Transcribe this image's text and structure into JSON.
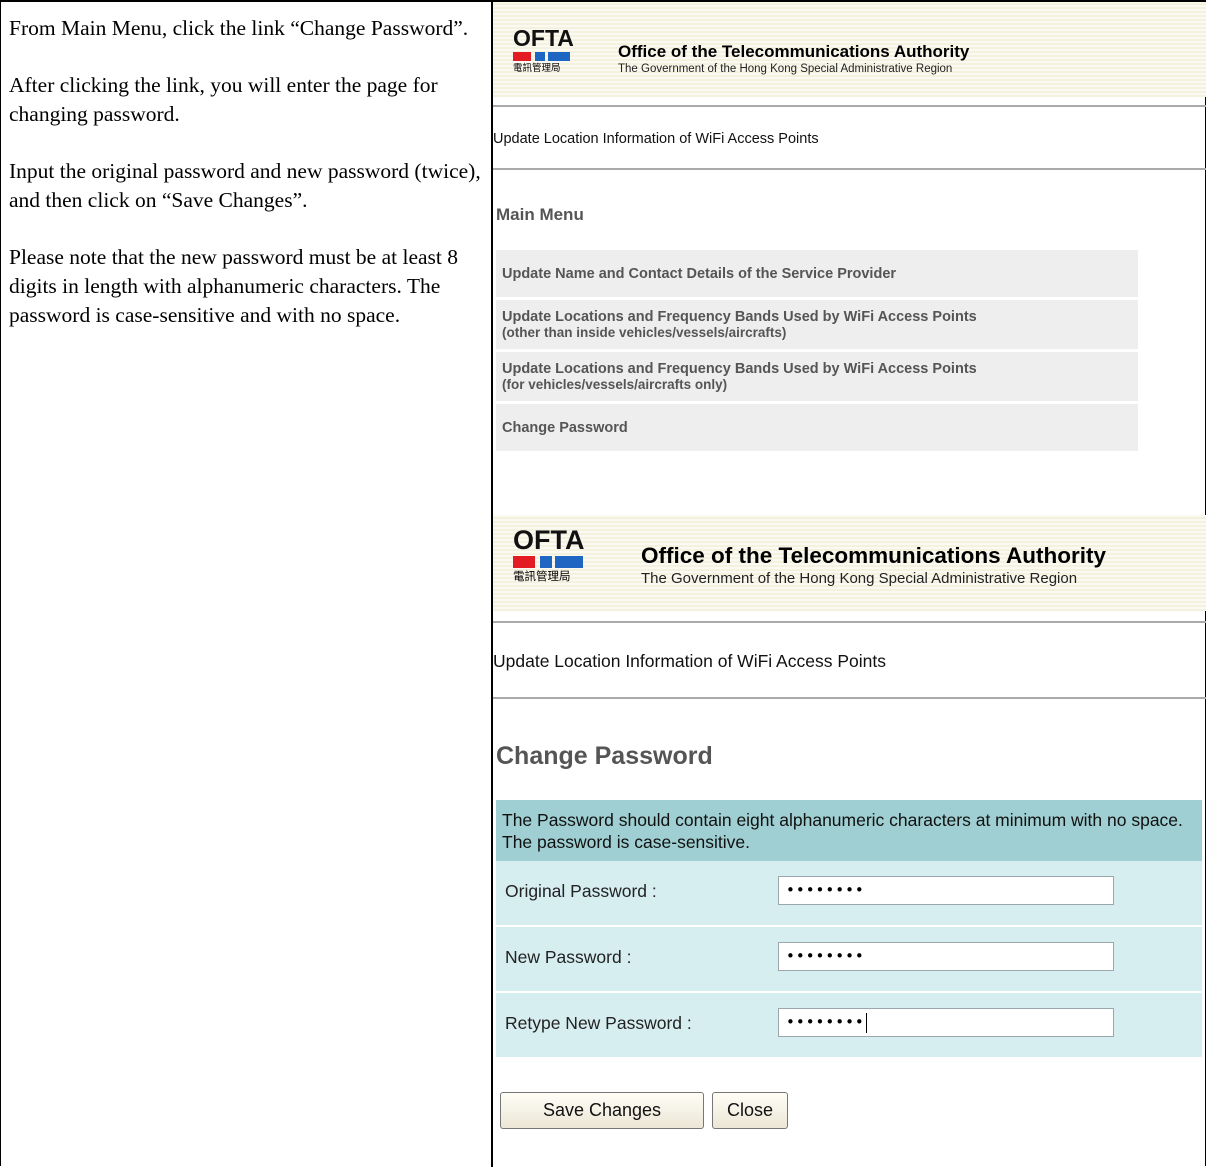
{
  "instructions": [
    "From Main Menu, click the link “Change Password”.",
    "After clicking the link, you will enter the page for changing password.",
    "Input the original password and new password (twice), and then click on “Save Changes”.",
    "Please note that the new password must be at least 8 digits in length with alphanumeric characters. The password is case-sensitive and with no space."
  ],
  "header": {
    "logo_text": "OFTA",
    "logo_chinese": "電訊管理局",
    "org_name": "Office of the Telecommunications Authority",
    "gov_name": "The Government of the Hong Kong Special Administrative Region",
    "brand_colors": {
      "red": "#e31b23",
      "blue": "#1f66c2"
    }
  },
  "subtitle": "Update Location Information of WiFi Access Points",
  "main_menu": {
    "title": "Main Menu",
    "items": [
      {
        "line1": "Update Name and Contact Details of the Service Provider",
        "line2": ""
      },
      {
        "line1": "Update Locations and Frequency Bands Used by WiFi Access Points",
        "line2": "(other than inside vehicles/vessels/aircrafts)"
      },
      {
        "line1": "Update Locations and Frequency Bands Used by WiFi Access Points",
        "line2": "(for vehicles/vessels/aircrafts only)"
      },
      {
        "line1": "Change Password",
        "line2": ""
      }
    ]
  },
  "change_password": {
    "title": "Change Password",
    "note": "The Password should contain eight alphanumeric characters at minimum with no space. The password is case-sensitive.",
    "fields": [
      {
        "label": "Original Password :",
        "value": "••••••••"
      },
      {
        "label": "New Password :",
        "value": "••••••••"
      },
      {
        "label": "Retype New Password :",
        "value": "••••••••"
      }
    ],
    "save_label": "Save Changes",
    "close_label": "Close"
  }
}
